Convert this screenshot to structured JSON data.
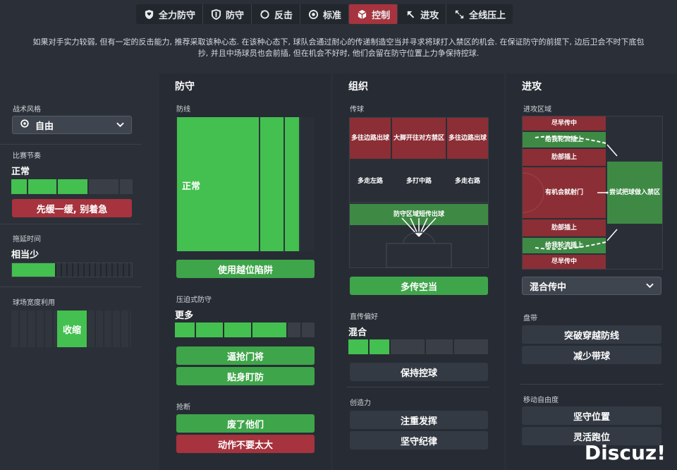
{
  "tabs": [
    {
      "label": "全力防守",
      "icon": "shield-heart-icon",
      "active": false
    },
    {
      "label": "防守",
      "icon": "shield-icon",
      "active": false
    },
    {
      "label": "反击",
      "icon": "counter-arrow-icon",
      "active": false
    },
    {
      "label": "标准",
      "icon": "target-icon",
      "active": false
    },
    {
      "label": "控制",
      "icon": "cube-icon",
      "active": true
    },
    {
      "label": "进攻",
      "icon": "arrow-up-left-icon",
      "active": false
    },
    {
      "label": "全线压上",
      "icon": "arrows-expand-icon",
      "active": false
    }
  ],
  "description": {
    "line1": "如果对手实力较弱, 但有一定的反击能力, 推荐采取该种心态. 在该种心态下, 球队会通过耐心的传递制造空当并寻求将球打入禁区的机会. 在保证防守的前提下, 边后卫会不时下底包",
    "line2": "抄, 并且中场球员也会前插, 但在机会不好时, 他们会留在防守位置上力争保持控球."
  },
  "left": {
    "style_label": "战术风格",
    "style_value": "自由",
    "tempo_label": "比赛节奏",
    "tempo_value": "正常",
    "tempo_level": 0.55,
    "tempo_button": "先缓一缓, 别着急",
    "timewasting_label": "拖延时间",
    "timewasting_value": "相当少",
    "timewasting_level": 0.35,
    "width_label": "球场宽度利用",
    "width_value": "收缩"
  },
  "defense": {
    "title": "防守",
    "line_label": "防线",
    "line_value": "正常",
    "offside_button": "使用越位陷阱",
    "press_label": "压迫式防守",
    "press_value": "更多",
    "press_level": 0.7,
    "press_btn1": "逼抢门将",
    "press_btn2": "贴身盯防",
    "tackle_label": "抢断",
    "tackle_btn1": "废了他们",
    "tackle_btn2": "动作不要太大"
  },
  "organisation": {
    "title": "组织",
    "passing_label": "传球",
    "pitch": {
      "r1c1": "多往边路出球",
      "r1c2": "大脚开往对方禁区",
      "r1c3": "多往边路出球",
      "r2c1": "多走左路",
      "r2c2": "多打中路",
      "r2c3": "多走右路",
      "band": "防守区域短传出球"
    },
    "passing_button": "多传空当",
    "directness_label": "直传偏好",
    "directness_value": "混合",
    "directness_level": 0.3,
    "directness_button": "保持控球",
    "creativity_label": "创造力",
    "creativity_btn1": "注重发挥",
    "creativity_btn2": "坚守纪律"
  },
  "attack": {
    "title": "进攻",
    "zone_label": "进攻区域",
    "pitch": {
      "early_cross_top": "尽早传中",
      "overlap_top": "给我轮流插上",
      "run_top": "肋部插上",
      "shoot": "有机会就射门",
      "box": "尝试把球做入禁区",
      "run_bottom": "肋部插上",
      "overlap_bottom": "给我轮流插上",
      "early_cross_bottom": "尽早传中"
    },
    "cross_dropdown": "混合传中",
    "dribble_label": "盘带",
    "dribble_btn1": "突破穿越防线",
    "dribble_btn2": "减少带球",
    "freedom_label": "移动自由度",
    "freedom_btn1": "坚守位置",
    "freedom_btn2": "灵活跑位"
  },
  "watermark": "Discuz!",
  "colors": {
    "green": "#43c04f",
    "dark_green": "#3e8a45",
    "red": "#a6333d",
    "dark_red": "#8b2e35",
    "bg": "#2b3038"
  }
}
